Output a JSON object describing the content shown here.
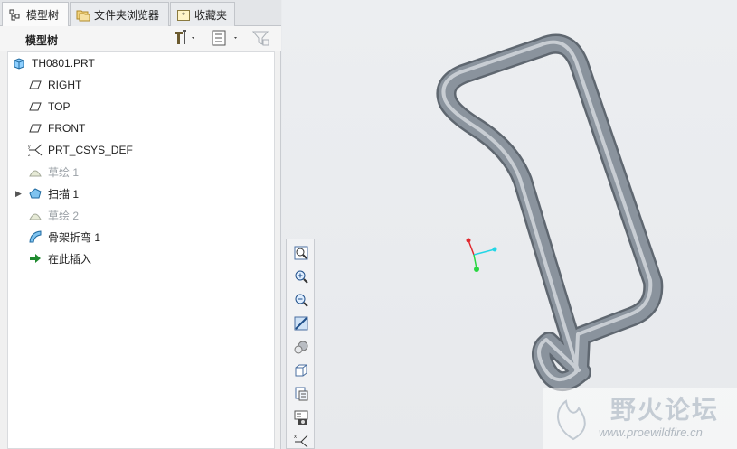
{
  "tabs": [
    {
      "label": "模型树",
      "icon": "model-tree-icon",
      "active": true
    },
    {
      "label": "文件夹浏览器",
      "icon": "folder-browser-icon",
      "active": false
    },
    {
      "label": "收藏夹",
      "icon": "favorites-icon",
      "active": false
    }
  ],
  "tree_header": {
    "title": "模型树",
    "tools_icon": "settings-tools-icon",
    "show_icon": "show-list-icon",
    "filter_icon": "filter-icon"
  },
  "tree": {
    "root": {
      "label": "TH0801.PRT",
      "icon": "part-icon"
    },
    "items": [
      {
        "label": "RIGHT",
        "icon": "datum-plane-icon",
        "dim": false,
        "expandable": false
      },
      {
        "label": "TOP",
        "icon": "datum-plane-icon",
        "dim": false,
        "expandable": false
      },
      {
        "label": "FRONT",
        "icon": "datum-plane-icon",
        "dim": false,
        "expandable": false
      },
      {
        "label": "PRT_CSYS_DEF",
        "icon": "csys-icon",
        "dim": false,
        "expandable": false
      },
      {
        "label": "草绘 1",
        "icon": "sketch-icon",
        "dim": true,
        "expandable": false
      },
      {
        "label": "扫描 1",
        "icon": "sweep-icon",
        "dim": false,
        "expandable": true
      },
      {
        "label": "草绘 2",
        "icon": "sketch-icon",
        "dim": true,
        "expandable": false
      },
      {
        "label": "骨架折弯 1",
        "icon": "spinal-bend-icon",
        "dim": false,
        "expandable": false
      },
      {
        "label": "在此插入",
        "icon": "insert-here-arrow-icon",
        "dim": false,
        "expandable": false
      }
    ]
  },
  "view_toolbar": [
    {
      "name": "refit-button",
      "icon": "refit-icon"
    },
    {
      "name": "zoom-in-button",
      "icon": "zoom-in-icon"
    },
    {
      "name": "zoom-out-button",
      "icon": "zoom-out-icon"
    },
    {
      "name": "repaint-button",
      "icon": "repaint-icon"
    },
    {
      "name": "display-style-button",
      "icon": "display-style-icon"
    },
    {
      "name": "saved-orientations-button",
      "icon": "saved-orientations-icon"
    },
    {
      "name": "view-manager-button",
      "icon": "view-manager-icon"
    },
    {
      "name": "datum-display-button",
      "icon": "datum-display-icon"
    },
    {
      "name": "csys-display-button",
      "icon": "csys-display-icon"
    }
  ],
  "watermark": {
    "title": "野火论坛",
    "url": "www.proewildfire.cn"
  },
  "colors": {
    "model_fill": "#8a939d",
    "model_highlight": "#d7dce1",
    "model_shadow": "#5f6770",
    "csys_red": "#e0282e",
    "csys_cyan": "#23d6e6",
    "csys_green": "#28d640"
  }
}
